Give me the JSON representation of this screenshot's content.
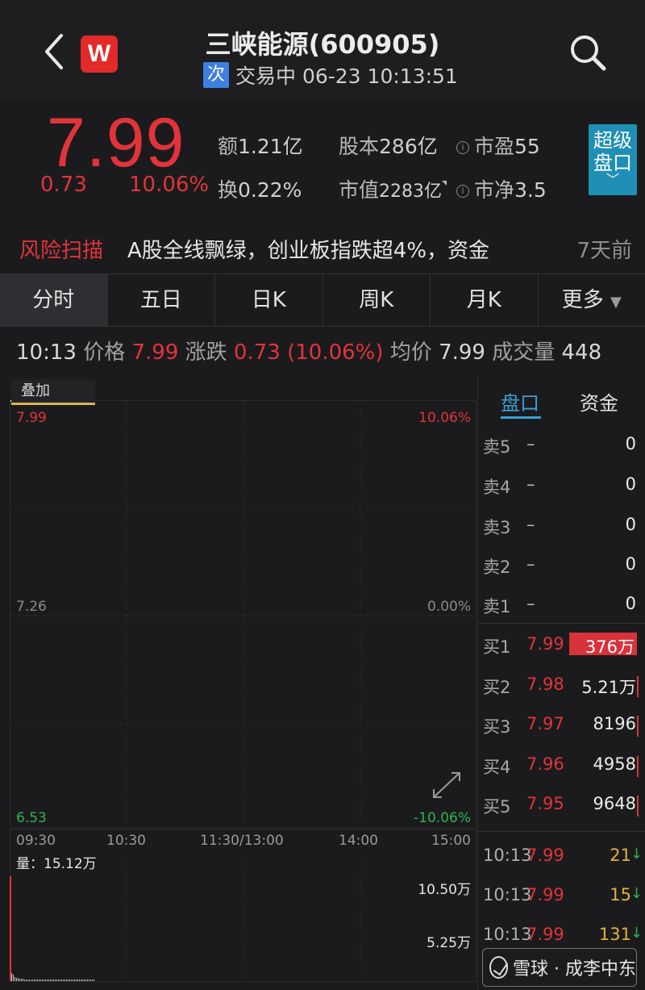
{
  "header": {
    "title": "三峡能源(600905)",
    "badge": "次",
    "status": "交易中 06-23 10:13:51",
    "logo_letter": "W"
  },
  "quote": {
    "price": "7.99",
    "change": "0.73",
    "change_pct": "10.06%",
    "stats": {
      "amount_label": "额",
      "amount": "1.21亿",
      "turnover_label": "换",
      "turnover": "0.22%",
      "shares_label": "股本",
      "shares": "286亿",
      "mktcap_label": "市值",
      "mktcap": "2283亿",
      "pe_label": "市盈",
      "pe": "55",
      "pb_label": "市净",
      "pb": "3.5"
    },
    "super_button": [
      "超级",
      "盘口"
    ]
  },
  "news": {
    "tag": "风险扫描",
    "text": "A股全线飘绿，创业板指跌超4%，资金",
    "time": "7天前"
  },
  "tabs": [
    "分时",
    "五日",
    "日K",
    "周K",
    "月K",
    "更多"
  ],
  "info_row": {
    "time": "10:13",
    "price_label": "价格",
    "price": "7.99",
    "change_label": "涨跌",
    "change": "0.73 (10.06%)",
    "avg_label": "均价",
    "avg": "7.99",
    "volume_label": "成交量",
    "volume": "448"
  },
  "chart": {
    "overlay_button": "叠加",
    "y_high": "7.99",
    "y_mid": "7.26",
    "y_low": "6.53",
    "pct_high": "10.06%",
    "pct_mid": "0.00%",
    "pct_low": "-10.06%",
    "x_labels": [
      "09:30",
      "10:30",
      "11:30/13:00",
      "14:00",
      "15:00"
    ],
    "vol_label": "量：15.12万",
    "vol_high": "10.50万",
    "vol_mid": "5.25万"
  },
  "chart_data": {
    "type": "line",
    "title": "",
    "xlabel": "",
    "ylabel": "",
    "x": [
      "09:30",
      "10:13"
    ],
    "series": [
      {
        "values": [
          7.99,
          7.99
        ]
      }
    ],
    "ylim": [
      6.53,
      7.99
    ],
    "grid": true
  },
  "side": {
    "tabs": [
      "盘口",
      "资金"
    ],
    "asks": [
      {
        "label": "卖5",
        "price": "–",
        "vol": "0"
      },
      {
        "label": "卖4",
        "price": "–",
        "vol": "0"
      },
      {
        "label": "卖3",
        "price": "–",
        "vol": "0"
      },
      {
        "label": "卖2",
        "price": "–",
        "vol": "0"
      },
      {
        "label": "卖1",
        "price": "–",
        "vol": "0"
      }
    ],
    "bids": [
      {
        "label": "买1",
        "price": "7.99",
        "vol": "376万"
      },
      {
        "label": "买2",
        "price": "7.98",
        "vol": "5.21万"
      },
      {
        "label": "买3",
        "price": "7.97",
        "vol": "8196"
      },
      {
        "label": "买4",
        "price": "7.96",
        "vol": "4958"
      },
      {
        "label": "买5",
        "price": "7.95",
        "vol": "9648"
      }
    ],
    "trades": [
      {
        "time": "10:13",
        "price": "7.99",
        "vol": "21"
      },
      {
        "time": "10:13",
        "price": "7.99",
        "vol": "15"
      },
      {
        "time": "10:13",
        "price": "7.99",
        "vol": "131"
      }
    ]
  },
  "watermark": "雪球 · 成李中东",
  "colors": {
    "up": "#e0343a",
    "down": "#2fb350",
    "accent": "#3a9fd6",
    "bg": "#1b1b1d"
  }
}
